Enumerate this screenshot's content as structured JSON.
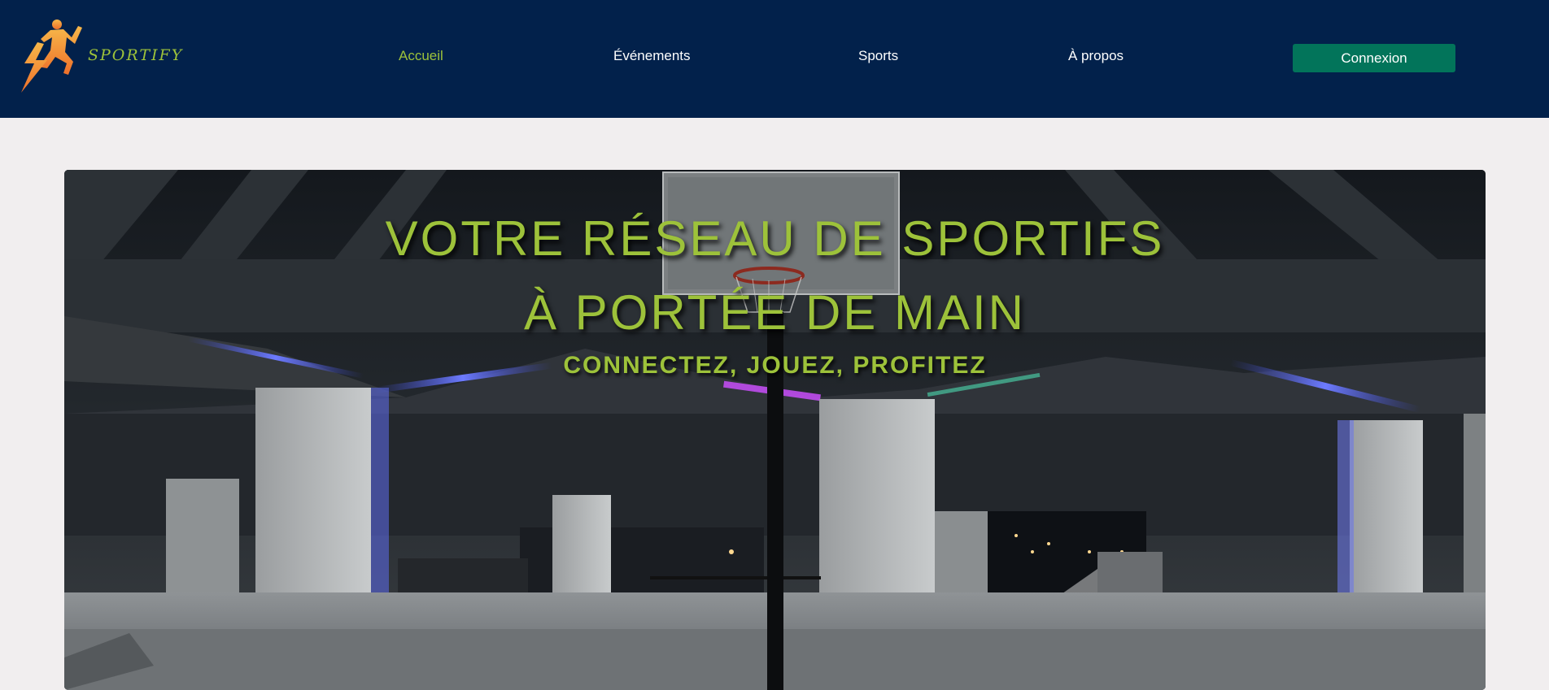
{
  "header": {
    "logo_text": "SPORTIFY",
    "nav": [
      {
        "label": "Accueil",
        "active": true
      },
      {
        "label": "Événements",
        "active": false
      },
      {
        "label": "Sports",
        "active": false
      },
      {
        "label": "À propos",
        "active": false
      }
    ],
    "login_label": "Connexion"
  },
  "hero": {
    "title_line1": "VOTRE RÉSEAU DE SPORTIFS",
    "title_line2": "À PORTÉE DE MAIN",
    "subtitle": "CONNECTEZ, JOUEZ, PROFITEZ",
    "background": "basketball-court-photo"
  },
  "colors": {
    "header_bg": "#02214b",
    "accent_green": "#9dc23a",
    "button_bg": "#02745a",
    "page_bg": "#f1eeef",
    "logo_orange": "#f0923a"
  }
}
